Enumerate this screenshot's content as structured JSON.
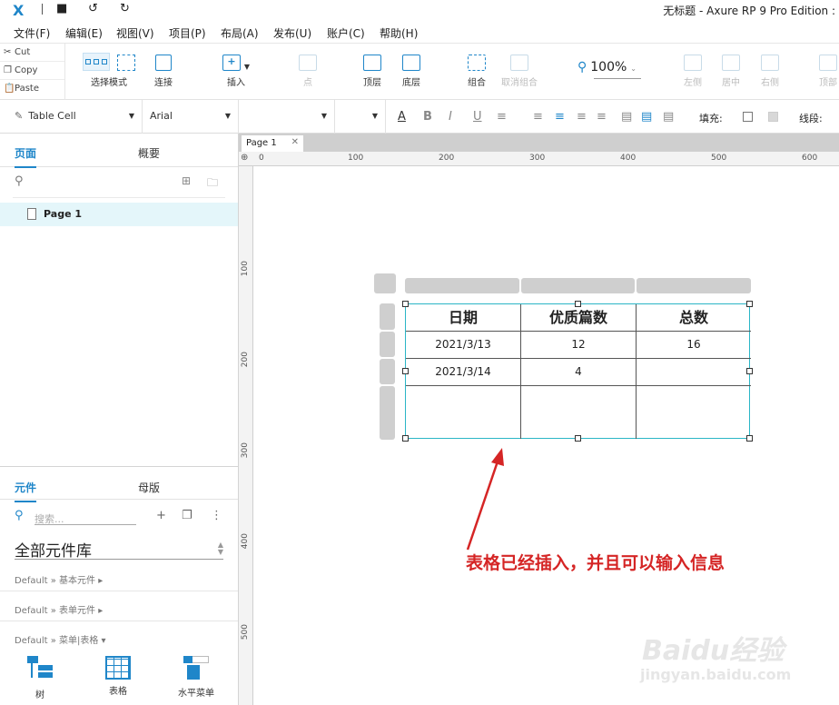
{
  "title_bar": {
    "logo": "X",
    "icons": [
      "save-icon",
      "undo-icon",
      "redo-icon"
    ],
    "window_title": "无标题 - Axure RP 9 Pro Edition :"
  },
  "menu": [
    "文件(F)",
    "编辑(E)",
    "视图(V)",
    "项目(P)",
    "布局(A)",
    "发布(U)",
    "账户(C)",
    "帮助(H)"
  ],
  "clipboard": {
    "cut": "Cut",
    "copy": "Copy",
    "paste": "Paste"
  },
  "toolbar": {
    "select_mode": "选择模式",
    "connect": "连接",
    "insert": "插入",
    "point": "点",
    "front": "顶层",
    "back": "底层",
    "group": "组合",
    "ungroup": "取消组合",
    "zoom": "100%",
    "align_left": "左侧",
    "align_center": "居中",
    "align_right": "右侧",
    "align_top": "顶部"
  },
  "format": {
    "style": "Table Cell",
    "font": "Arial",
    "fill_label": "填充:",
    "line_label": "线段:"
  },
  "pages_panel": {
    "tab_pages": "页面",
    "tab_outline": "概要",
    "page1": "Page 1"
  },
  "library_panel": {
    "tab_widgets": "元件",
    "tab_masters": "母版",
    "search_placeholder": "搜索...",
    "library": "全部元件库",
    "sections": [
      "Default » 基本元件 ▸",
      "Default » 表单元件 ▸",
      "Default » 菜单|表格 ▾"
    ],
    "widgets": [
      "树",
      "表格",
      "水平菜单"
    ]
  },
  "canvas": {
    "tab_label": "Page 1",
    "h_ruler": [
      "0",
      "100",
      "200",
      "300",
      "400",
      "500",
      "600"
    ],
    "v_ruler": [
      "100",
      "200",
      "300",
      "400",
      "500"
    ],
    "table": {
      "headers": [
        "日期",
        "优质篇数",
        "总数"
      ],
      "rows": [
        [
          "2021/3/13",
          "12",
          "16"
        ],
        [
          "2021/3/14",
          "4",
          ""
        ],
        [
          "",
          "",
          ""
        ]
      ]
    },
    "annotation": "表格已经插入，并且可以输入信息",
    "watermark_logo": "Baidu经验",
    "watermark_url": "jingyan.baidu.com"
  },
  "colors": {
    "accent": "#1f86c9",
    "selection": "#2bb6c6",
    "annotation": "#d52525",
    "page_selected": "#e4f6fa"
  }
}
